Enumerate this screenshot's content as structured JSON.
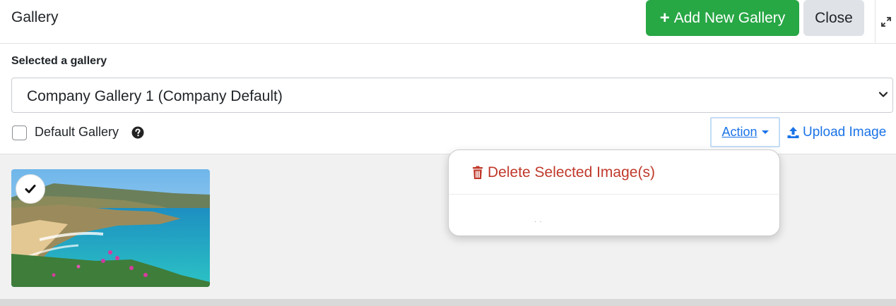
{
  "header": {
    "title": "Gallery",
    "add_button": "Add New Gallery",
    "close_button": "Close",
    "add_color": "#28a745"
  },
  "selector": {
    "label": "Selected a gallery",
    "value": "Company Gallery 1 (Company Default)"
  },
  "options": {
    "default_label": "Default Gallery",
    "default_checked": false
  },
  "toolbar": {
    "action_label": "Action",
    "upload_label": "Upload Image",
    "link_color": "#1a73e8"
  },
  "menu": {
    "delete_label": "Delete Selected Image(s)",
    "danger_color": "#c0392b"
  },
  "gallery": {
    "images": [
      {
        "selected": true
      }
    ]
  }
}
